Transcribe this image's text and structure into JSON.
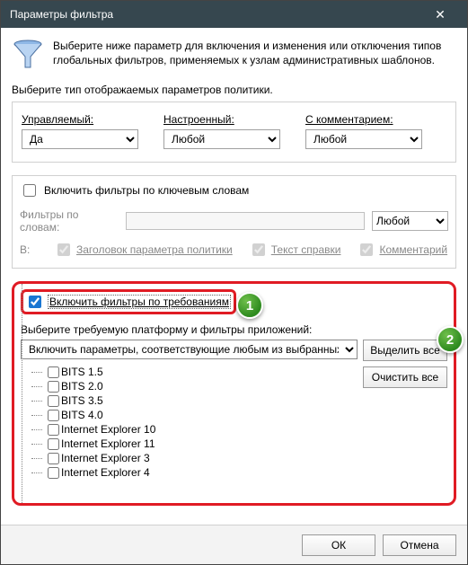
{
  "window": {
    "title": "Параметры фильтра"
  },
  "intro": "Выберите ниже параметр для включения и изменения или отключения типов глобальных фильтров, применяемых к узлам административных шаблонов.",
  "policy_label": "Выберите тип отображаемых параметров политики.",
  "cols": {
    "managed": {
      "label": "Управляемый:",
      "value": "Да"
    },
    "configured": {
      "label": "Настроенный:",
      "value": "Любой"
    },
    "commented": {
      "label": "С комментарием:",
      "value": "Любой"
    }
  },
  "keywords": {
    "enable_label": "Включить фильтры по ключевым словам",
    "filter_row_label": "Фильтры по словам:",
    "match_value": "Любой",
    "in_label": "В:",
    "c1": "Заголовок параметра политики",
    "c2": "Текст справки",
    "c3": "Комментарий"
  },
  "req": {
    "enable_label": "Включить фильтры по требованиям",
    "platform_label": "Выберите требуемую платформу и фильтры приложений:",
    "select_value": "Включить параметры, соответствующие любым из выбранных пла",
    "select_all": "Выделить все",
    "clear_all": "Очистить все",
    "items": [
      "BITS 1.5",
      "BITS 2.0",
      "BITS 3.5",
      "BITS 4.0",
      "Internet Explorer 10",
      "Internet Explorer 11",
      "Internet Explorer 3",
      "Internet Explorer 4"
    ]
  },
  "footer": {
    "ok": "ОК",
    "cancel": "Отмена"
  },
  "markers": {
    "m1": "1",
    "m2": "2"
  }
}
